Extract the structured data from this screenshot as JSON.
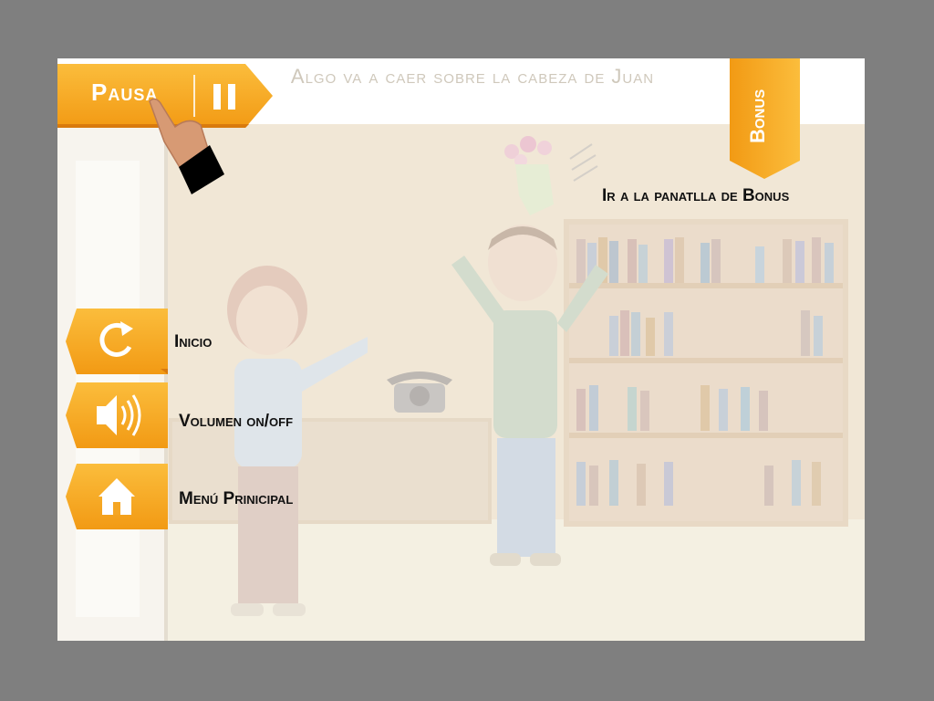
{
  "header": {
    "title": "Algo va a caer sobre la cabeza de Juan"
  },
  "pause": {
    "label": "Pausa",
    "icon": "pause-icon"
  },
  "bonus": {
    "tab_label": "Bonus",
    "hint": "Ir a la panatlla de Bonus"
  },
  "menu": {
    "items": [
      {
        "label": "Inicio",
        "icon": "restart-icon"
      },
      {
        "label": "Volumen on/off",
        "icon": "speaker-icon"
      },
      {
        "label": "Menú Prinicipal",
        "icon": "home-icon"
      }
    ]
  },
  "colors": {
    "accent_orange": "#f7a21b",
    "accent_orange_dark": "#e07c10",
    "background_gray": "#7f7f7f"
  }
}
